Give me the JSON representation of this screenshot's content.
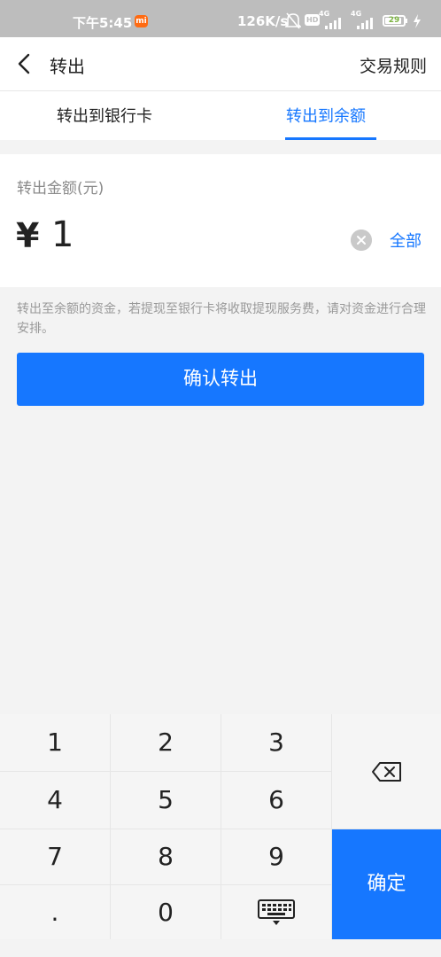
{
  "status": {
    "time": "下午5:45",
    "mi_badge": "mi",
    "net_speed": "126K/s",
    "hd_badge": "HD",
    "net1": "4G",
    "net2": "4G",
    "battery": "29"
  },
  "header": {
    "title": "转出",
    "rules_link": "交易规则"
  },
  "tabs": [
    {
      "label": "转出到银行卡",
      "active": false
    },
    {
      "label": "转出到余额",
      "active": true
    }
  ],
  "amount": {
    "label": "转出金额(元)",
    "currency": "¥",
    "value": "1",
    "all_label": "全部"
  },
  "note": "转出至余额的资金，若提现至银行卡将收取提现服务费，请对资金进行合理安排。",
  "confirm_label": "确认转出",
  "keypad": {
    "keys": [
      "1",
      "2",
      "3",
      "4",
      "5",
      "6",
      "7",
      "8",
      "9",
      ".",
      "0"
    ],
    "ok_label": "确定"
  },
  "colors": {
    "accent": "#1677ff",
    "statusbar": "#bdbdbd"
  }
}
